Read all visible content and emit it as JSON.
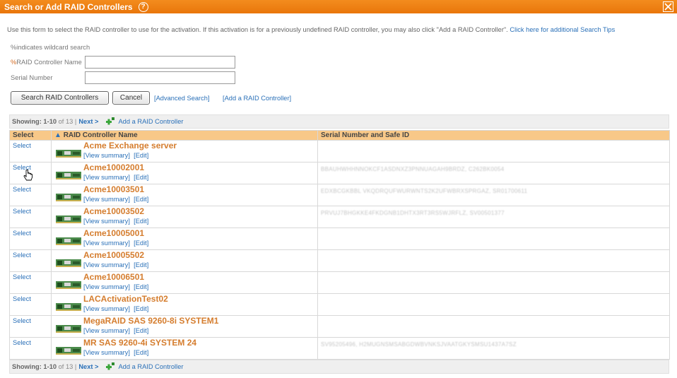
{
  "dialog": {
    "title": "Search or Add RAID Controllers",
    "help_icon": "?",
    "close_icon": "close-icon"
  },
  "intro": {
    "text": "Use this form to select the RAID controller to use for the activation. If this activation is for a previously undefined RAID controller, you may also click \"Add a RAID Controller\".",
    "tips_link": "Click here for additional Search Tips"
  },
  "form": {
    "wildcard_hint": "%indicates wildcard search",
    "name_label_pct": "%",
    "name_label": "RAID Controller Name",
    "name_value": "",
    "serial_label": "Serial Number",
    "serial_value": "",
    "search_button": "Search RAID Controllers",
    "cancel_button": "Cancel",
    "advanced_link": "[Advanced Search]",
    "add_link": "[Add a RAID Controller]"
  },
  "pager": {
    "showing_label": "Showing:",
    "range": "1-10",
    "of_text": "of 13 |",
    "next": "Next >",
    "add_controller": "Add a RAID Controller"
  },
  "table": {
    "headers": {
      "select": "Select",
      "name": "RAID Controller Name",
      "serial": "Serial Number and Safe ID"
    },
    "rows": [
      {
        "select": "Select",
        "name": "Acme Exchange server",
        "view": "[View summary]",
        "edit": "[Edit]",
        "serial": ""
      },
      {
        "select": "Select",
        "name": "Acme10002001",
        "view": "[View summary]",
        "edit": "[Edit]",
        "serial": "BBAUHWHHNNOKCF1ASDNXZ3PNNUAGAH9BRDZ, C262BK0054"
      },
      {
        "select": "Select",
        "name": "Acme10003501",
        "view": "[View summary]",
        "edit": "[Edit]",
        "serial": "EDXBCGKBBL VKQDRQUFWURWNTS2K2UFWBRXSPRGAZ, SR01700611"
      },
      {
        "select": "Select",
        "name": "Acme10003502",
        "view": "[View summary]",
        "edit": "[Edit]",
        "serial": "PRVUJ7BHGKKE4FKDGNB1DHTX3RT3RS5WJRFLZ, SV00501377"
      },
      {
        "select": "Select",
        "name": "Acme10005001",
        "view": "[View summary]",
        "edit": "[Edit]",
        "serial": ""
      },
      {
        "select": "Select",
        "name": "Acme10005502",
        "view": "[View summary]",
        "edit": "[Edit]",
        "serial": ""
      },
      {
        "select": "Select",
        "name": "Acme10006501",
        "view": "[View summary]",
        "edit": "[Edit]",
        "serial": ""
      },
      {
        "select": "Select",
        "name": "LACActivationTest02",
        "view": "[View summary]",
        "edit": "[Edit]",
        "serial": ""
      },
      {
        "select": "Select",
        "name": "MegaRAID SAS 9260-8i SYSTEM1",
        "view": "[View summary]",
        "edit": "[Edit]",
        "serial": ""
      },
      {
        "select": "Select",
        "name": "MR SAS 9260-4i SYSTEM 24",
        "view": "[View summary]",
        "edit": "[Edit]",
        "serial": "SV95205496, H2MUGNSMSABGDWBVNKSJVAATGKYSMSU1437A7SZ"
      }
    ]
  },
  "colors": {
    "titlebar": "#f0800f",
    "header": "#f8c888",
    "link": "#2a70b8",
    "controller_name": "#d57d2e"
  }
}
